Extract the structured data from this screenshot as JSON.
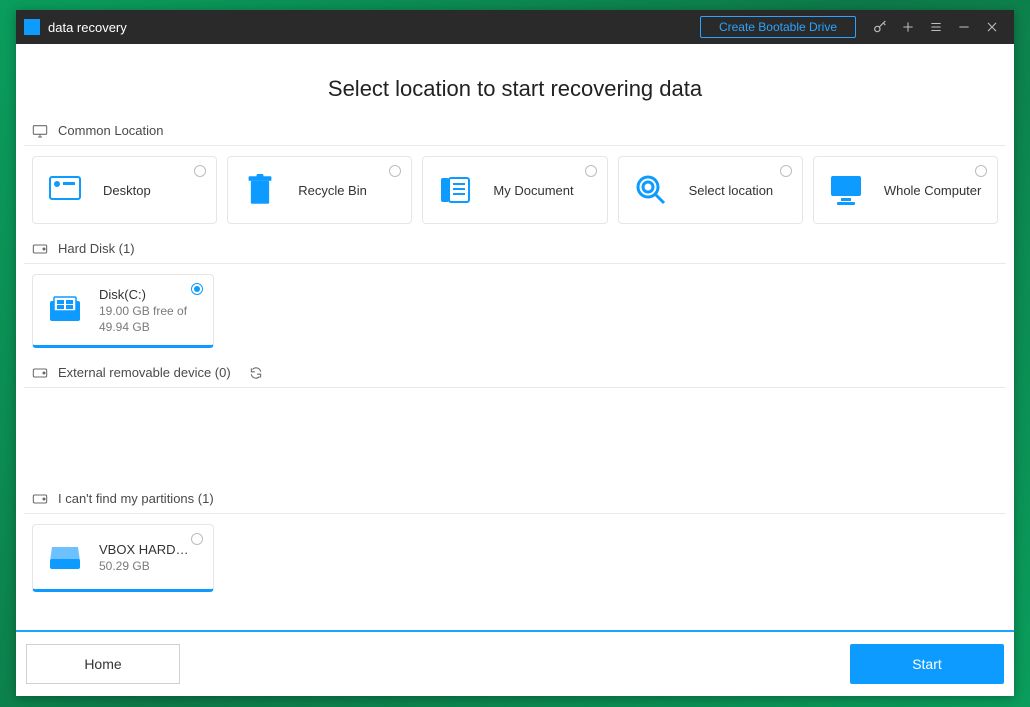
{
  "titlebar": {
    "app_name": "data recovery",
    "bootable_label": "Create Bootable Drive"
  },
  "heading": "Select location to start recovering data",
  "sections": {
    "common": {
      "label": "Common Location"
    },
    "hard_disk": {
      "label": "Hard Disk (1)"
    },
    "external": {
      "label": "External removable device (0)"
    },
    "lost": {
      "label": "I can't find my partitions (1)"
    }
  },
  "common_items": [
    {
      "label": "Desktop"
    },
    {
      "label": "Recycle Bin"
    },
    {
      "label": "My Document"
    },
    {
      "label": "Select location"
    },
    {
      "label": "Whole Computer"
    }
  ],
  "disks": [
    {
      "name": "Disk(C:)",
      "free_line1": "19.00 GB  free of",
      "free_line2": "49.94 GB"
    }
  ],
  "lost_partitions": [
    {
      "name": "VBOX HARDDISK...",
      "size": "50.29 GB"
    }
  ],
  "footer": {
    "home": "Home",
    "start": "Start"
  }
}
